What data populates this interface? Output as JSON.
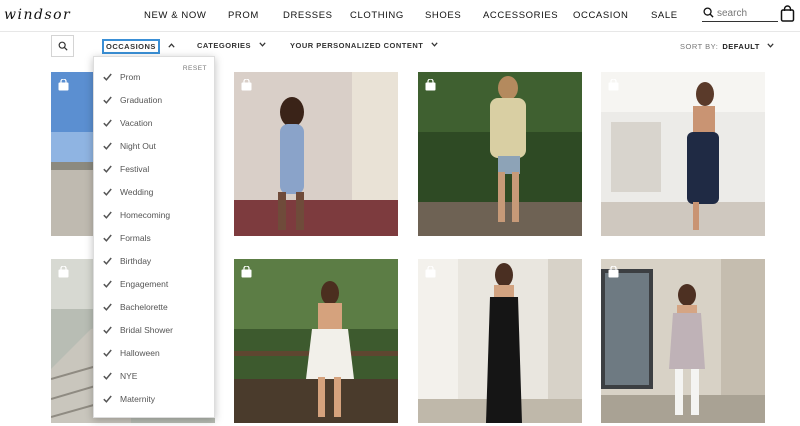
{
  "brand": {
    "logo_text": "WINDSOR"
  },
  "nav": {
    "items": [
      "NEW & NOW",
      "PROM",
      "DRESSES",
      "CLOTHING",
      "SHOES",
      "ACCESSORIES",
      "OCCASION",
      "SALE"
    ],
    "search_placeholder": "search",
    "search_icon": "search-icon",
    "bag_icon": "shopping-bag-icon"
  },
  "filters": {
    "occasions_label": "OCCASIONS",
    "categories_label": "CATEGORIES",
    "personalized_label": "YOUR PERSONALIZED CONTENT",
    "sort_label": "SORT BY:",
    "sort_value": "DEFAULT",
    "accent_color": "#3a8fd6"
  },
  "occasion_dropdown": {
    "reset_label": "RESET",
    "options": [
      "Prom",
      "Graduation",
      "Vacation",
      "Night Out",
      "Festival",
      "Wedding",
      "Homecoming",
      "Formals",
      "Birthday",
      "Engagement",
      "Bachelorette",
      "Bridal Shower",
      "Halloween",
      "NYE",
      "Maternity"
    ]
  },
  "grid": {
    "tiles": [
      {
        "icon": "shopping-bag-icon",
        "scene": "parking lot under blue sky"
      },
      {
        "icon": "shopping-bag-icon",
        "scene": "gingham dress, ornate wallpaper"
      },
      {
        "icon": "shopping-bag-icon",
        "scene": "blazer outfit, green hedges"
      },
      {
        "icon": "shopping-bag-icon",
        "scene": "navy slip dress, white interior"
      },
      {
        "icon": "shopping-bag-icon",
        "scene": "outdoor stairs"
      },
      {
        "icon": "shopping-bag-icon",
        "scene": "white mini dress, trees"
      },
      {
        "icon": "shopping-bag-icon",
        "scene": "black strapless gown"
      },
      {
        "icon": "shopping-bag-icon",
        "scene": "floral mini dress, storefront"
      }
    ]
  }
}
